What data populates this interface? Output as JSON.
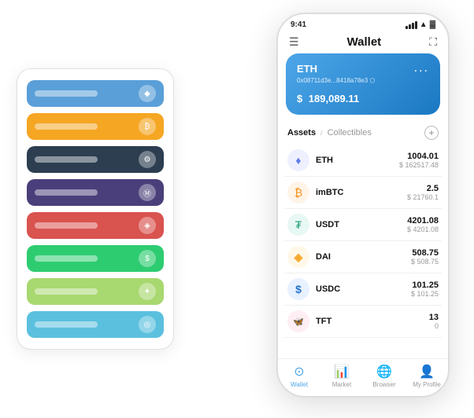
{
  "page": {
    "bg": "#ffffff"
  },
  "statusBar": {
    "time": "9:41",
    "battery": "🔋",
    "wifi": "📶"
  },
  "nav": {
    "menuIcon": "☰",
    "title": "Wallet",
    "expandIcon": "⛶"
  },
  "ethCard": {
    "label": "ETH",
    "dots": "...",
    "address": "0x08711d3e...8418a78e3 ⬡",
    "currency": "$",
    "balance": "189,089.11"
  },
  "assetsHeader": {
    "activeTab": "Assets",
    "divider": "/",
    "inactiveTab": "Collectibles",
    "addIcon": "+"
  },
  "assets": [
    {
      "name": "ETH",
      "iconColor": "#627eea",
      "iconSymbol": "♦",
      "amount": "1004.01",
      "usd": "$ 162517.48"
    },
    {
      "name": "imBTC",
      "iconColor": "#f7931a",
      "iconSymbol": "₿",
      "amount": "2.5",
      "usd": "$ 21760.1"
    },
    {
      "name": "USDT",
      "iconColor": "#26a17b",
      "iconSymbol": "₮",
      "amount": "4201.08",
      "usd": "$ 4201.08"
    },
    {
      "name": "DAI",
      "iconColor": "#f5a623",
      "iconSymbol": "◈",
      "amount": "508.75",
      "usd": "$ 508.75"
    },
    {
      "name": "USDC",
      "iconColor": "#2775ca",
      "iconSymbol": "$",
      "amount": "101.25",
      "usd": "$ 101.25"
    },
    {
      "name": "TFT",
      "iconColor": "#e8406c",
      "iconSymbol": "🦋",
      "amount": "13",
      "usd": "0"
    }
  ],
  "bottomNav": [
    {
      "label": "Wallet",
      "icon": "⊙",
      "active": true
    },
    {
      "label": "Market",
      "icon": "📈",
      "active": false
    },
    {
      "label": "Browser",
      "icon": "🌐",
      "active": false
    },
    {
      "label": "My Profile",
      "icon": "👤",
      "active": false
    }
  ],
  "cardStack": [
    {
      "color": "card-blue"
    },
    {
      "color": "card-yellow"
    },
    {
      "color": "card-dark"
    },
    {
      "color": "card-purple"
    },
    {
      "color": "card-red"
    },
    {
      "color": "card-green"
    },
    {
      "color": "card-light-green"
    },
    {
      "color": "card-sky"
    }
  ]
}
